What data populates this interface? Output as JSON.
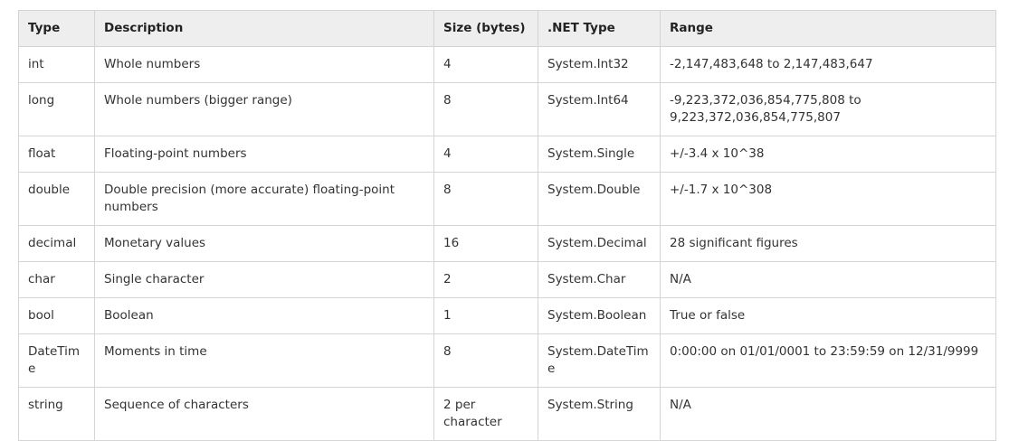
{
  "table": {
    "headers": [
      "Type",
      "Description",
      "Size (bytes)",
      ".NET Type",
      "Range"
    ],
    "rows": [
      [
        "int",
        "Whole numbers",
        "4",
        "System.Int32",
        "-2,147,483,648 to 2,147,483,647"
      ],
      [
        "long",
        "Whole numbers (bigger range)",
        "8",
        "System.Int64",
        "-9,223,372,036,854,775,808 to 9,223,372,036,854,775,807"
      ],
      [
        "float",
        "Floating-point numbers",
        "4",
        "System.Single",
        "+/-3.4 x 10^38"
      ],
      [
        "double",
        "Double precision (more accurate) floating-point numbers",
        "8",
        "System.Double",
        "+/-1.7 x 10^308"
      ],
      [
        "decimal",
        "Monetary values",
        "16",
        "System.Decimal",
        "28 significant figures"
      ],
      [
        "char",
        "Single character",
        "2",
        "System.Char",
        "N/A"
      ],
      [
        "bool",
        "Boolean",
        "1",
        "System.Boolean",
        "True or false"
      ],
      [
        "DateTime",
        "Moments in time",
        "8",
        "System.DateTime",
        "0:00:00 on 01/01/0001 to 23:59:59 on 12/31/9999"
      ],
      [
        "string",
        "Sequence of characters",
        "2 per character",
        "System.String",
        "N/A"
      ]
    ]
  }
}
